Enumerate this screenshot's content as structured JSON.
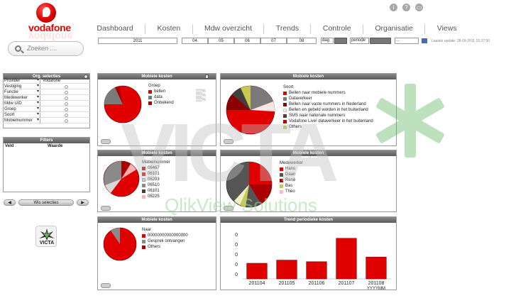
{
  "brand": {
    "name": "vodafone"
  },
  "menu": [
    "Dashboard",
    "Kosten",
    "Mdw overzicht",
    "Trends",
    "Controle",
    "Organisatie",
    "Views"
  ],
  "top_icons": [
    "info-icon",
    "help-icon",
    "print-icon"
  ],
  "search": {
    "placeholder": "Zoeken ...."
  },
  "filter_bar": {
    "year": "2011",
    "months": [
      "04",
      "05",
      "06",
      "07",
      "08"
    ],
    "granularity": "dag",
    "period": "periode",
    "extra": "...",
    "last_update": "Laatste update: 28-09-2011 15:37:50"
  },
  "selection_panel": {
    "title": "Org. selecties",
    "rows": [
      {
        "label": "Provider",
        "value": "Vodafone"
      },
      {
        "label": "Vestiging",
        "value": ""
      },
      {
        "label": "Functie",
        "value": ""
      },
      {
        "label": "Medewerker",
        "value": ""
      },
      {
        "label": "Mdw UID",
        "value": ""
      },
      {
        "label": "Groep",
        "value": ""
      },
      {
        "label": "Soort",
        "value": ""
      },
      {
        "label": "Mobielnummer",
        "value": ""
      }
    ]
  },
  "filters_panel": {
    "title": "Filters",
    "col_field": "Veld",
    "col_value": "Waarde"
  },
  "buttons": {
    "clear": "Wis selecties"
  },
  "victa_logo": "VICTA",
  "watermark": {
    "main": "VICTA",
    "sub": "QlikView Solutions"
  },
  "panels": {
    "p1": {
      "title": "Mobiele kosten",
      "legend_title": "Groep",
      "items": [
        "bellen",
        "data",
        "Onbekend"
      ]
    },
    "p2": {
      "title": "Mobiele kosten",
      "legend_title": "Soort",
      "items": [
        "Bellen naar mobiele nummers",
        "Dataverkeer",
        "Bellen naar vaste nummers in Nederland",
        "Bellen en gebeld worden in het buitenland",
        "SMS naar nationale nummers",
        "Vodafone Live! dataverkeer in het buitenland",
        "Others"
      ]
    },
    "p3": {
      "title": "Mobiele kosten",
      "legend_title": "Mobielnummer",
      "items": [
        "06467",
        "06101",
        "06203",
        "06510",
        "06101",
        "06225"
      ]
    },
    "p4": {
      "title": "Mobiele kosten",
      "legend_title": "Medewerker",
      "items": [
        "Hans",
        "Daan",
        "René",
        "Bas",
        "Theo"
      ]
    },
    "p5": {
      "title": "Mobiele kosten",
      "legend_title": "Naar",
      "items": [
        "00000000000000000",
        "Gesprek ontvangen",
        "Others"
      ]
    },
    "p6": {
      "title": "Trend periodieke kosten"
    }
  },
  "colors": {
    "red": "#e00000",
    "dark": "#404040",
    "grey": "#8a8a8a",
    "olive": "#b8b84a",
    "pink": "#f0c0c0"
  },
  "chart_data": {
    "type": "bar",
    "title": "Trend periodieke kosten",
    "categories": [
      "201104",
      "201105",
      "201106",
      "201107",
      "201108"
    ],
    "xlabel": "YYYYMM",
    "y_ticks": [
      "0",
      "0",
      "0",
      "0",
      "0"
    ],
    "values": [
      0.2,
      0.24,
      0.22,
      0.52,
      0.28
    ],
    "value_note": "values are relative estimates; axis labels obscured"
  }
}
